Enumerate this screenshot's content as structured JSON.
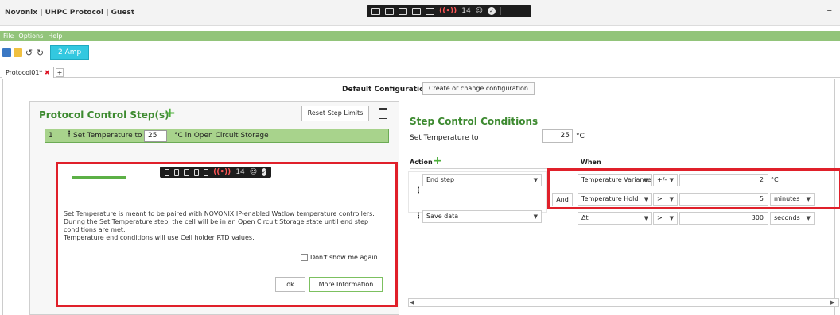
{
  "window": {
    "title": "Novonix | UHPC Protocol | Guest",
    "minimize": "–"
  },
  "recorder_toolbar": {
    "count": "14",
    "ok": "✓"
  },
  "menu": {
    "items": [
      "File",
      "Options",
      "Help"
    ]
  },
  "toolbar": {
    "amp_button": "2 Amp"
  },
  "tabs": {
    "protocol_tab": "Protocol01*",
    "close": "✖",
    "add": "+"
  },
  "config": {
    "label": "Default Configuration",
    "button": "Create or change configuration"
  },
  "left_panel": {
    "title": "Protocol Control Step(s)",
    "add": "+",
    "reset_button": "Reset Step Limits",
    "step": {
      "number": "1",
      "label": "Set Temperature to",
      "value": "25",
      "suffix": "°C in Open Circuit Storage"
    }
  },
  "dialog": {
    "message_1": "Set Temperature is meant to be paired with NOVONIX IP-enabled Watlow temperature controllers.",
    "message_2": "During the Set Temperature step, the cell will be in an Open Circuit Storage state until end step",
    "message_3": "conditions are met.",
    "message_4": "Temperature end conditions will use Cell holder RTD values.",
    "dont_show": "Don't show me again",
    "ok_button": "ok",
    "more_button": "More Information"
  },
  "right_panel": {
    "title": "Step Control Conditions",
    "set_temp_label": "Set Temperature to",
    "set_temp_value": "25",
    "set_temp_unit": "°C",
    "action_header": "Action",
    "action_add": "+",
    "when_header": "When",
    "rows": [
      {
        "action": "End step",
        "condition": "Temperature Variance",
        "op": "+/-",
        "value": "2",
        "unit": "°C"
      },
      {
        "and": "And",
        "condition": "Temperature Hold",
        "op": ">",
        "value": "5",
        "unit": "minutes"
      },
      {
        "action": "Save data",
        "condition": "Δt",
        "op": ">",
        "value": "300",
        "unit": "seconds"
      }
    ]
  }
}
